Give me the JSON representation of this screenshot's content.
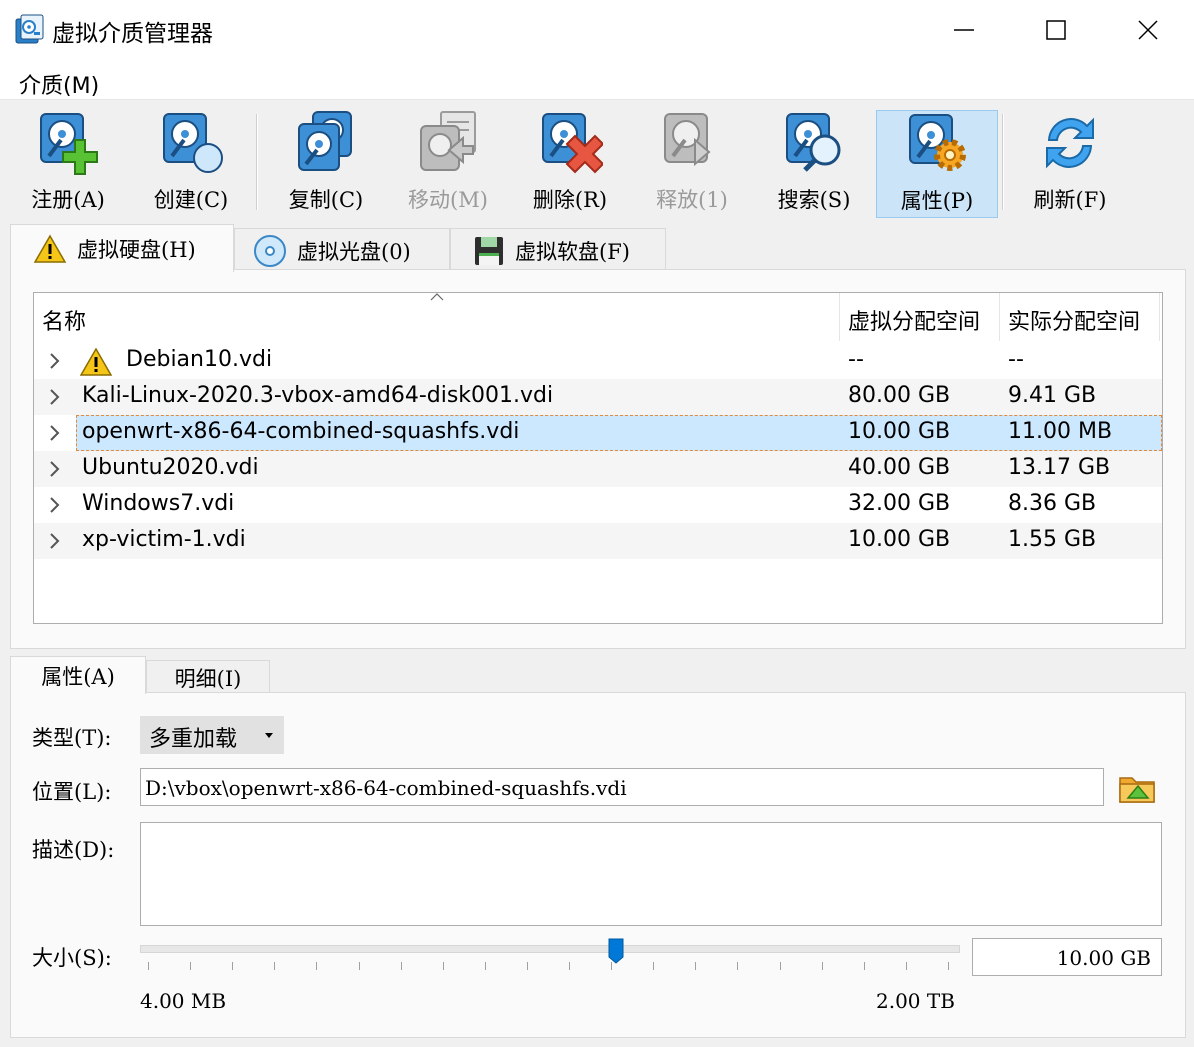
{
  "window": {
    "title": "虚拟介质管理器"
  },
  "menu": {
    "media": "介质(M)"
  },
  "toolbar": {
    "register": "注册(A)",
    "create": "创建(C)",
    "copy": "复制(C)",
    "move": "移动(M)",
    "remove": "删除(R)",
    "release": "释放(1)",
    "search": "搜索(S)",
    "properties": "属性(P)",
    "refresh": "刷新(F)"
  },
  "media_tabs": {
    "hard_disk": "虚拟硬盘(H)",
    "optical_disk": "虚拟光盘(0)",
    "floppy_disk": "虚拟软盘(F)"
  },
  "table": {
    "columns": {
      "name": "名称",
      "virtual_size": "虚拟分配空间",
      "actual_size": "实际分配空间"
    },
    "rows": [
      {
        "name": "Debian10.vdi",
        "virtual_size": "--",
        "actual_size": "--",
        "warning": true
      },
      {
        "name": "Kali-Linux-2020.3-vbox-amd64-disk001.vdi",
        "virtual_size": "80.00 GB",
        "actual_size": "9.41 GB"
      },
      {
        "name": "openwrt-x86-64-combined-squashfs.vdi",
        "virtual_size": "10.00 GB",
        "actual_size": "11.00 MB",
        "selected": true
      },
      {
        "name": "Ubuntu2020.vdi",
        "virtual_size": "40.00 GB",
        "actual_size": "13.17 GB"
      },
      {
        "name": "Windows7.vdi",
        "virtual_size": "32.00 GB",
        "actual_size": "8.36 GB"
      },
      {
        "name": "xp-victim-1.vdi",
        "virtual_size": "10.00 GB",
        "actual_size": "1.55 GB"
      }
    ]
  },
  "detail_tabs": {
    "attributes": "属性(A)",
    "information": "明细(I)"
  },
  "form": {
    "type_label": "类型(T):",
    "type_value": "多重加载",
    "location_label": "位置(L):",
    "location_value": "D:\\vbox\\openwrt-x86-64-combined-squashfs.vdi",
    "description_label": "描述(D):",
    "description_value": "",
    "size_label": "大小(S):",
    "size_value": "10.00 GB",
    "size_min": "4.00 MB",
    "size_max": "2.00 TB",
    "size_slider_fraction": 0.58
  },
  "colors": {
    "selection": "#cce8ff",
    "accent": "#0078d7",
    "warning": "#f5c518"
  }
}
